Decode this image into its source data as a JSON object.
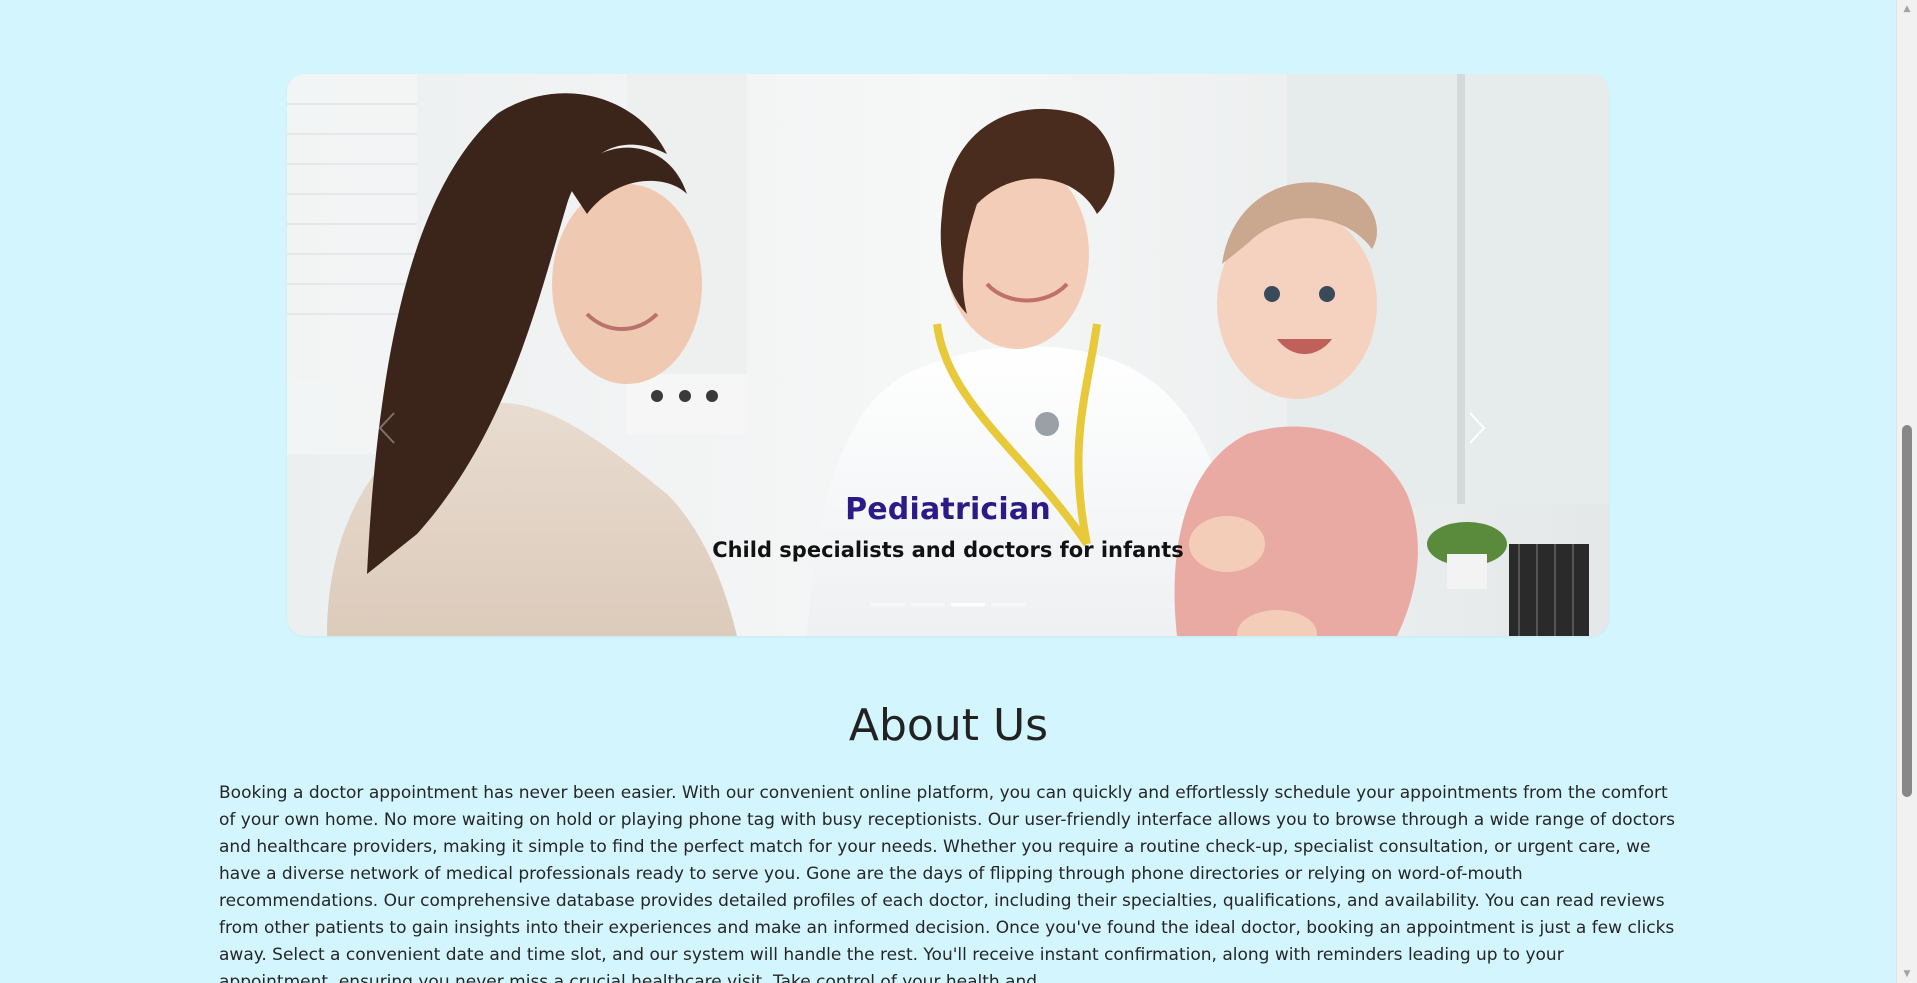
{
  "carousel": {
    "caption_title": "Pediatrician",
    "caption_subtitle": "Child specialists and doctors for infants",
    "indicator_count": 4,
    "active_indicator": 3,
    "prev_icon": "chevron-left-icon",
    "next_icon": "chevron-right-icon",
    "image_subject": "pediatrician-with-mother-and-baby-photo"
  },
  "about": {
    "title": "About Us",
    "text": "Booking a doctor appointment has never been easier. With our convenient online platform, you can quickly and effortlessly schedule your appointments from the comfort of your own home. No more waiting on hold or playing phone tag with busy receptionists. Our user-friendly interface allows you to browse through a wide range of doctors and healthcare providers, making it simple to find the perfect match for your needs. Whether you require a routine check-up, specialist consultation, or urgent care, we have a diverse network of medical professionals ready to serve you. Gone are the days of flipping through phone directories or relying on word-of-mouth recommendations. Our comprehensive database provides detailed profiles of each doctor, including their specialties, qualifications, and availability. You can read reviews from other patients to gain insights into their experiences and make an informed decision. Once you've found the ideal doctor, booking an appointment is just a few clicks away. Select a convenient date and time slot, and our system will handle the rest. You'll receive instant confirmation, along with reminders leading up to your appointment, ensuring you never miss a crucial healthcare visit. Take control of your health and"
  },
  "colors": {
    "page_background": "#d3f5fd",
    "caption_title": "#2c1a86",
    "caption_subtitle": "#121212"
  }
}
